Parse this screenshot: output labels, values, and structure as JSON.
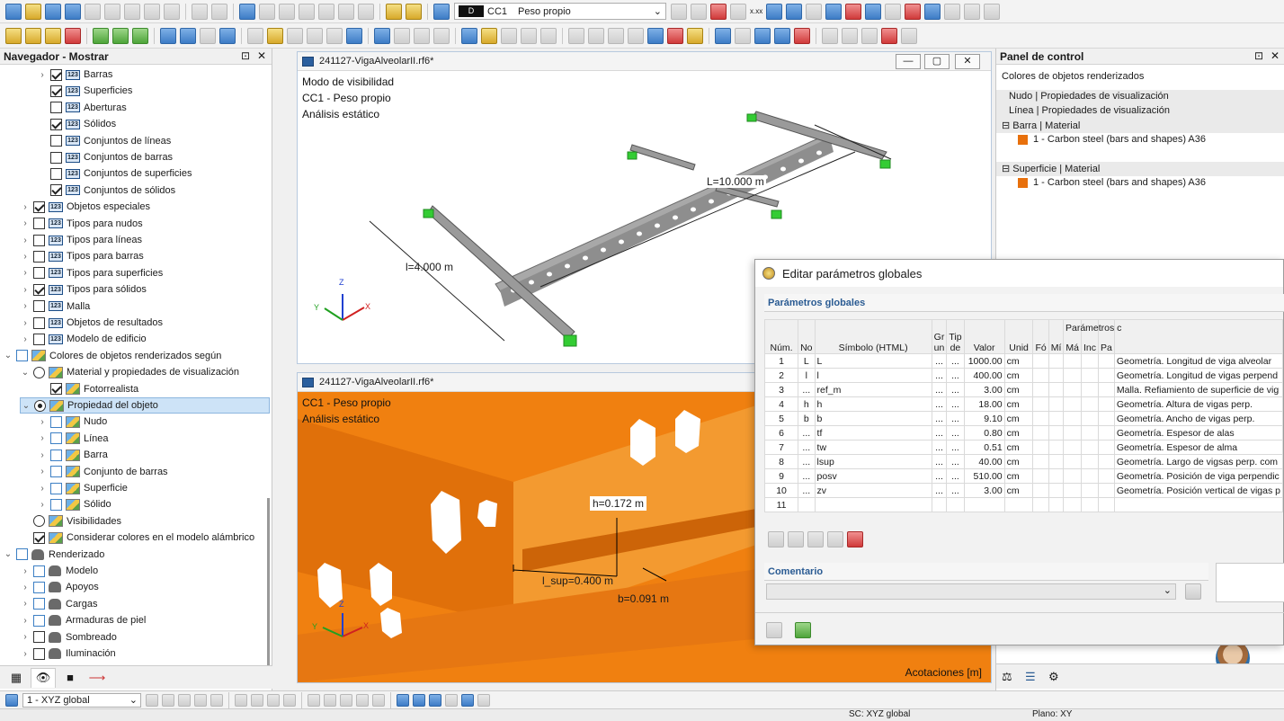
{
  "toolbar": {
    "load_case_code": "D",
    "load_case_id": "CC1",
    "load_case_name": "Peso propio",
    "xxx_label": "x.xx"
  },
  "navigator": {
    "title": "Navegador - Mostrar",
    "items": [
      {
        "label": "Barras",
        "ind": 3,
        "cb": "on",
        "icon": "123",
        "ex": "›"
      },
      {
        "label": "Superficies",
        "ind": 3,
        "cb": "on",
        "icon": "123",
        "ex": ""
      },
      {
        "label": "Aberturas",
        "ind": 3,
        "cb": "off",
        "icon": "123",
        "ex": ""
      },
      {
        "label": "Sólidos",
        "ind": 3,
        "cb": "on",
        "icon": "123",
        "ex": ""
      },
      {
        "label": "Conjuntos de líneas",
        "ind": 3,
        "cb": "off",
        "icon": "123",
        "ex": ""
      },
      {
        "label": "Conjuntos de barras",
        "ind": 3,
        "cb": "off",
        "icon": "123",
        "ex": ""
      },
      {
        "label": "Conjuntos de superficies",
        "ind": 3,
        "cb": "off",
        "icon": "123",
        "ex": ""
      },
      {
        "label": "Conjuntos de sólidos",
        "ind": 3,
        "cb": "on",
        "icon": "123",
        "ex": ""
      },
      {
        "label": "Objetos especiales",
        "ind": 2,
        "cb": "on",
        "icon": "123",
        "ex": "›"
      },
      {
        "label": "Tipos para nudos",
        "ind": 2,
        "cb": "off",
        "icon": "123",
        "ex": "›"
      },
      {
        "label": "Tipos para líneas",
        "ind": 2,
        "cb": "off",
        "icon": "123",
        "ex": "›"
      },
      {
        "label": "Tipos para barras",
        "ind": 2,
        "cb": "off",
        "icon": "123",
        "ex": "›"
      },
      {
        "label": "Tipos para superficies",
        "ind": 2,
        "cb": "off",
        "icon": "123",
        "ex": "›"
      },
      {
        "label": "Tipos para sólidos",
        "ind": 2,
        "cb": "on",
        "icon": "123",
        "ex": "›"
      },
      {
        "label": "Malla",
        "ind": 2,
        "cb": "off",
        "icon": "123",
        "ex": "›"
      },
      {
        "label": "Objetos de resultados",
        "ind": 2,
        "cb": "off",
        "icon": "123",
        "ex": "›"
      },
      {
        "label": "Modelo de edificio",
        "ind": 2,
        "cb": "off",
        "icon": "123",
        "ex": "›"
      },
      {
        "label": "Colores de objetos renderizados según",
        "ind": 1,
        "cb": "bl",
        "icon": "pen",
        "ex": "⌄"
      },
      {
        "label": "Material y propiedades de visualización",
        "ind": 2,
        "cb": "rb",
        "icon": "pen",
        "ex": "⌄"
      },
      {
        "label": "Fotorrealista",
        "ind": 3,
        "cb": "on",
        "icon": "pen",
        "ex": ""
      },
      {
        "label": "Propiedad del objeto",
        "ind": 2,
        "cb": "rbon",
        "icon": "pen",
        "ex": "⌄",
        "sel": true
      },
      {
        "label": "Nudo",
        "ind": 3,
        "cb": "bl",
        "icon": "pen",
        "ex": "›"
      },
      {
        "label": "Línea",
        "ind": 3,
        "cb": "bl",
        "icon": "pen",
        "ex": "›"
      },
      {
        "label": "Barra",
        "ind": 3,
        "cb": "bl",
        "icon": "pen",
        "ex": "›"
      },
      {
        "label": "Conjunto de barras",
        "ind": 3,
        "cb": "bl",
        "icon": "pen",
        "ex": "›"
      },
      {
        "label": "Superficie",
        "ind": 3,
        "cb": "bl",
        "icon": "pen",
        "ex": "›"
      },
      {
        "label": "Sólido",
        "ind": 3,
        "cb": "bl",
        "icon": "pen",
        "ex": "›"
      },
      {
        "label": "Visibilidades",
        "ind": 2,
        "cb": "rb",
        "icon": "pen",
        "ex": ""
      },
      {
        "label": "Considerar colores en el modelo alámbrico",
        "ind": 2,
        "cb": "on",
        "icon": "pen",
        "ex": ""
      },
      {
        "label": "Renderizado",
        "ind": 1,
        "cb": "bl",
        "icon": "pot",
        "ex": "⌄"
      },
      {
        "label": "Modelo",
        "ind": 2,
        "cb": "bl",
        "icon": "pot",
        "ex": "›"
      },
      {
        "label": "Apoyos",
        "ind": 2,
        "cb": "bl",
        "icon": "pot",
        "ex": "›"
      },
      {
        "label": "Cargas",
        "ind": 2,
        "cb": "bl",
        "icon": "pot",
        "ex": "›"
      },
      {
        "label": "Armaduras de piel",
        "ind": 2,
        "cb": "bl",
        "icon": "pot",
        "ex": "›"
      },
      {
        "label": "Sombreado",
        "ind": 2,
        "cb": "off",
        "icon": "pot",
        "ex": "›"
      },
      {
        "label": "Iluminación",
        "ind": 2,
        "cb": "off",
        "icon": "pot",
        "ex": "›"
      }
    ]
  },
  "viewport_top": {
    "title": "241127-VigaAlveolarII.rf6*",
    "line1": "Modo de visibilidad",
    "line2": "CC1 - Peso propio",
    "line3": "Análisis estático",
    "dim_L": "L=10.000 m",
    "dim_l": "l=4.000 m"
  },
  "viewport_bottom": {
    "title": "241127-VigaAlveolarII.rf6*",
    "line1": "CC1 - Peso propio",
    "line2": "Análisis estático",
    "dim_h": "h=0.172 m",
    "dim_lsup": "l_sup=0.400 m",
    "dim_b": "b=0.091 m",
    "footer": "Acotaciones [m]"
  },
  "axes": {
    "x": "X",
    "y": "Y",
    "z": "Z"
  },
  "control_panel": {
    "title": "Panel de control",
    "subtitle": "Colores de objetos renderizados",
    "row1": "Nudo | Propiedades de visualización",
    "row2": "Línea | Propiedades de visualización",
    "group1": "Barra | Material",
    "item1": "1 - Carbon steel (bars and shapes) A36",
    "group2": "Superficie | Material",
    "item2": "1 - Carbon steel (bars and shapes) A36"
  },
  "dialog": {
    "title": "Editar parámetros globales",
    "section": "Parámetros globales",
    "headers": {
      "num": "Núm.",
      "name": "No",
      "symbol": "Símbolo (HTML)",
      "group": "Gr un",
      "type": "Tip de",
      "value": "Valor",
      "unit": "Unid",
      "formula": "Fó",
      "params": "Parámetros c",
      "min": "Mí",
      "max": "Má",
      "inc": "Inc",
      "pas": "Pa"
    },
    "rows": [
      {
        "n": "1",
        "name": "L",
        "sym": "L",
        "value": "1000.00",
        "unit": "cm",
        "desc": "Geometría. Longitud de viga alveolar"
      },
      {
        "n": "2",
        "name": "l",
        "sym": "l",
        "value": "400.00",
        "unit": "cm",
        "desc": "Geometría. Longitud de vigas perpend"
      },
      {
        "n": "3",
        "name": "...",
        "sym": "ref_m",
        "value": "3.00",
        "unit": "cm",
        "desc": "Malla. Refiamiento de superficie de vig"
      },
      {
        "n": "4",
        "name": "h",
        "sym": "h",
        "value": "18.00",
        "unit": "cm",
        "desc": "Geometría. Altura de vigas perp."
      },
      {
        "n": "5",
        "name": "b",
        "sym": "b",
        "value": "9.10",
        "unit": "cm",
        "desc": "Geometría. Ancho de vigas perp."
      },
      {
        "n": "6",
        "name": "...",
        "sym": "tf",
        "value": "0.80",
        "unit": "cm",
        "desc": "Geometría. Espesor de alas"
      },
      {
        "n": "7",
        "name": "...",
        "sym": "tw",
        "value": "0.51",
        "unit": "cm",
        "desc": "Geometría. Espesor de alma"
      },
      {
        "n": "8",
        "name": "...",
        "sym": "lsup",
        "value": "40.00",
        "unit": "cm",
        "desc": "Geometría. Largo de vigsas perp. com"
      },
      {
        "n": "9",
        "name": "...",
        "sym": "posv",
        "value": "510.00",
        "unit": "cm",
        "desc": "Geometría. Posición de viga perpendic"
      },
      {
        "n": "10",
        "name": "...",
        "sym": "zv",
        "value": "3.00",
        "unit": "cm",
        "desc": "Geometría. Posición vertical de vigas p"
      },
      {
        "n": "11",
        "name": "",
        "sym": "",
        "value": "",
        "unit": "",
        "desc": ""
      }
    ],
    "dots": "...",
    "comment_label": "Comentario"
  },
  "bottom": {
    "coord_system": "1 - XYZ global"
  },
  "status": {
    "sc": "SC: XYZ global",
    "plane": "Plano: XY"
  }
}
